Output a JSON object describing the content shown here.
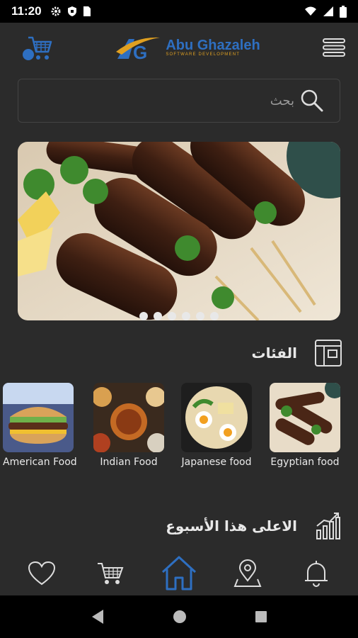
{
  "status": {
    "time": "11:20"
  },
  "header": {
    "logo_name": "Abu Ghazaleh",
    "logo_sub": "SOFTWARE DEVELOPMENT"
  },
  "search": {
    "placeholder": "بحث"
  },
  "banner": {
    "slide_count": 6,
    "active_index": 0
  },
  "categories_section": {
    "title": "الفئات"
  },
  "categories": [
    {
      "label": "American Food"
    },
    {
      "label": "Indian Food"
    },
    {
      "label": "Japanese food"
    },
    {
      "label": "Egyptian food"
    }
  ],
  "top_week_section": {
    "title": "الاعلى هذا الأسبوع"
  },
  "colors": {
    "accent": "#2e6fc1",
    "background": "#2b2b2b",
    "logo_orange": "#e0a020"
  },
  "bottom_nav": [
    "heart-icon",
    "cart-icon",
    "home-icon",
    "location-icon",
    "bell-icon"
  ]
}
